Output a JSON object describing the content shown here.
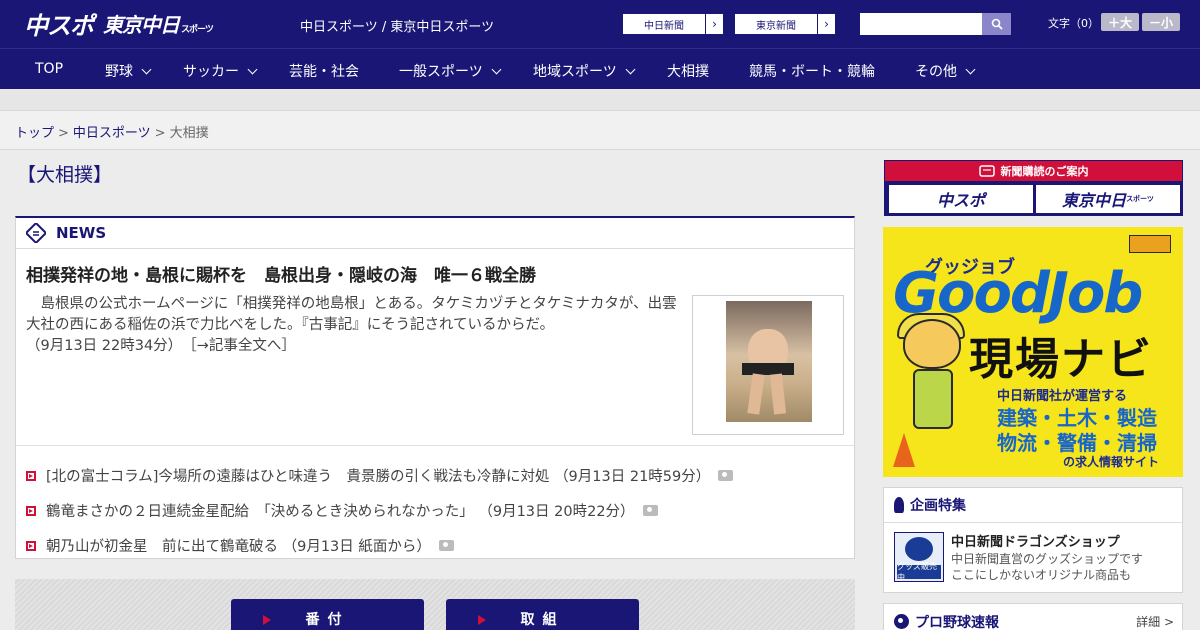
{
  "header": {
    "logo_primary": "中スポ",
    "logo_secondary": "東京中日",
    "logo_secondary_small": "スポーツ",
    "site_name": "中日スポーツ / 東京中日スポーツ",
    "links": [
      {
        "label": "中日新聞"
      },
      {
        "label": "東京新聞"
      }
    ],
    "search": {
      "value": "",
      "placeholder": ""
    },
    "fontsize": {
      "label": "文字（0）",
      "larger": "＋大",
      "smaller": "－小"
    }
  },
  "nav": {
    "items": [
      {
        "label": "TOP"
      },
      {
        "label": "野球"
      },
      {
        "label": "サッカー"
      },
      {
        "label": "芸能・社会"
      },
      {
        "label": "一般スポーツ"
      },
      {
        "label": "地域スポーツ"
      },
      {
        "label": "大相撲"
      },
      {
        "label": "競馬・ボート・競輪"
      },
      {
        "label": "その他"
      }
    ]
  },
  "breadcrumb": {
    "items": [
      "トップ",
      "中日スポーツ",
      "大相撲"
    ],
    "separator": ">"
  },
  "page_title": "【大相撲】",
  "news": {
    "section_label": "NEWS",
    "top_story": {
      "headline": "相撲発祥の地・島根に賜杯を　島根出身・隠岐の海　唯一６戦全勝",
      "lead": "島根県の公式ホームページに「相撲発祥の地島根」とある。タケミカヅチとタケミナカタが、出雲大社の西にある稲佐の浜で力比べをした。『古事記』にそう記されているからだ。",
      "timestamp": "（9月13日 22時34分）",
      "more_link": "［→記事全文へ］"
    },
    "items": [
      {
        "title": "[北の富士コラム]今場所の遠藤はひと味違う　貴景勝の引く戦法も冷静に対処",
        "time": "（9月13日 21時59分）"
      },
      {
        "title": "鶴竜まさかの２日連続金星配給　「決めるとき決められなかった」",
        "time": "（9月13日 20時22分）"
      },
      {
        "title": "朝乃山が初金星　前に出て鶴竜破る",
        "time": "（9月13日 紙面から）"
      }
    ]
  },
  "tabs": [
    {
      "label": "番付"
    },
    {
      "label": "取組"
    }
  ],
  "sidebar": {
    "subscribe": {
      "title": "新聞購読のご案内",
      "logo_left": "中スポ",
      "logo_right": "東京中日",
      "logo_right_small": "スポーツ"
    },
    "ad": {
      "top": "グッジョブ",
      "brand": "GoodJob",
      "headline": "現場ナビ",
      "by": "中日新聞社が運営する",
      "industries_1": "建築・土木・製造",
      "industries_2": "物流・警備・清掃",
      "footer": "の求人情報サイト"
    },
    "feature": {
      "title": "企画特集",
      "shop_title": "中日新聞ドラゴンズショップ",
      "shop_desc_1": "中日新聞直営のグッズショップです",
      "shop_desc_2": "ここにしかないオリジナル商品も",
      "shop_badge": "グッズ販売中"
    },
    "baseball": {
      "title": "プロ野球速報",
      "more": "詳細 >"
    }
  },
  "colors": {
    "brand_navy": "#1a1676",
    "accent_red": "#d0103a",
    "ad_yellow": "#f6e51b"
  }
}
